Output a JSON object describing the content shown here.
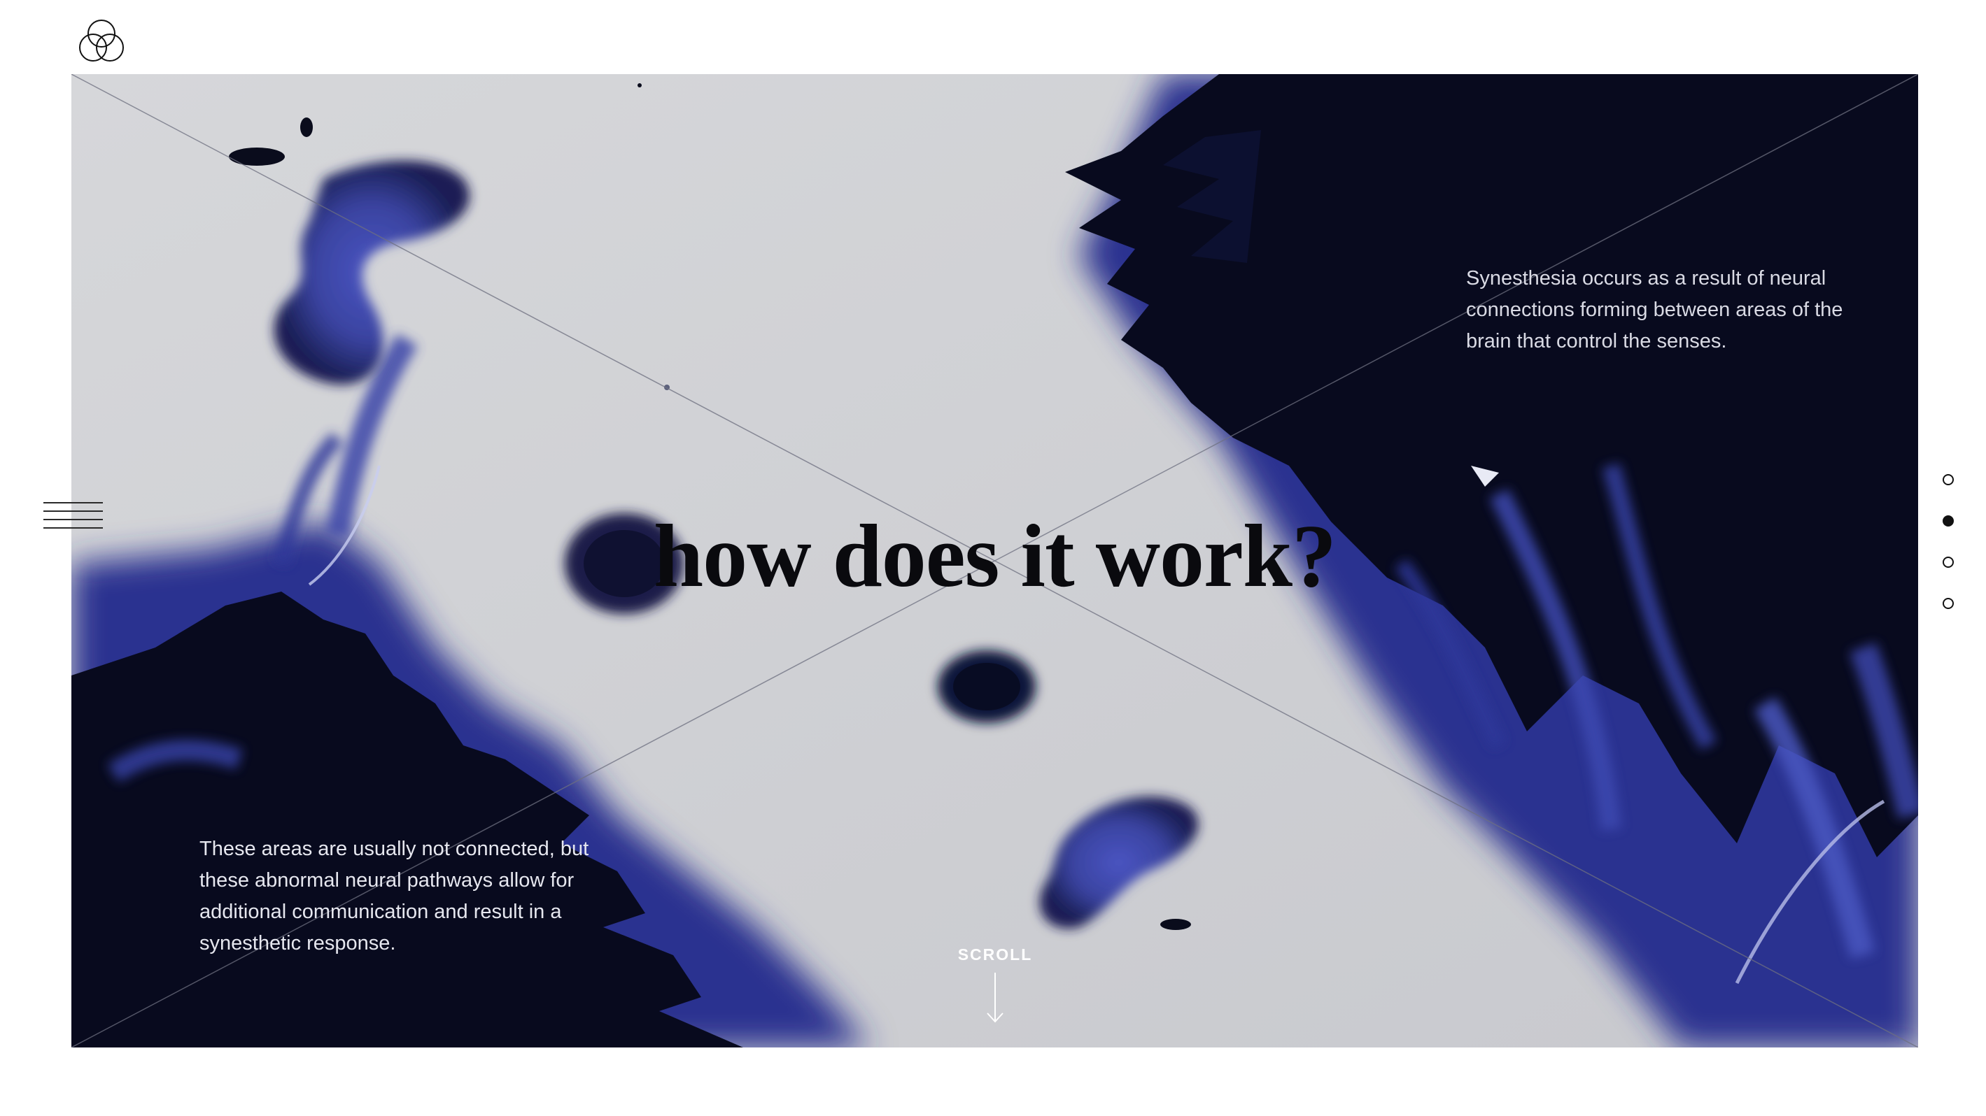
{
  "header": {
    "logo_icon": "three-circles-logo-icon"
  },
  "hero": {
    "headline": "how does it work?",
    "paragraph_right": "Synesthesia occurs as a result of neural connections forming between areas of the brain that control the senses.",
    "paragraph_left": "These areas are usually not connected, but these abnormal neural pathways allow for additional communication and result in a synesthetic response.",
    "scroll_label": "SCROLL",
    "scroll_icon": "arrow-down-icon"
  },
  "nav": {
    "menu_icon": "hamburger-menu-icon"
  },
  "pager": {
    "count": 4,
    "active_index": 1
  },
  "colors": {
    "ink_dark": "#080a1e",
    "ink_blue": "#3a45a8",
    "paper": "#cfd0d4",
    "headline": "#0a0a0e"
  }
}
